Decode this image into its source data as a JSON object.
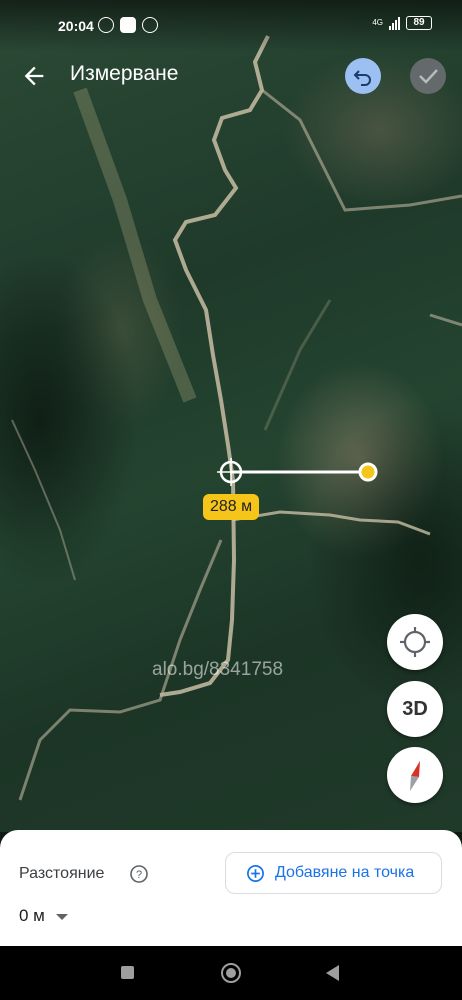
{
  "status_bar": {
    "time": "20:04",
    "network": "4G",
    "battery": "89"
  },
  "header": {
    "title": "Измерване",
    "back_icon": "arrow-back-icon",
    "undo_icon": "undo-icon",
    "done_icon": "check-icon"
  },
  "map": {
    "distance_label": "288 м",
    "watermark": "alo.bg/8341758",
    "view_mode_label": "3D",
    "location_icon": "my-location-icon",
    "compass_icon": "compass-icon"
  },
  "bottom_sheet": {
    "distance_title": "Разстояние",
    "help_icon": "help-circle-icon",
    "distance_value": "0 м",
    "add_point_label": "Добавяне на точка",
    "add_point_icon": "add-circle-icon"
  },
  "nav_bar": {
    "recents_icon": "square-icon",
    "home_icon": "home-circle-icon",
    "back_icon": "triangle-back-icon"
  },
  "colors": {
    "accent": "#1a73e8",
    "label_bg": "#f5c519",
    "undo_bg": "#9dc0f2"
  }
}
